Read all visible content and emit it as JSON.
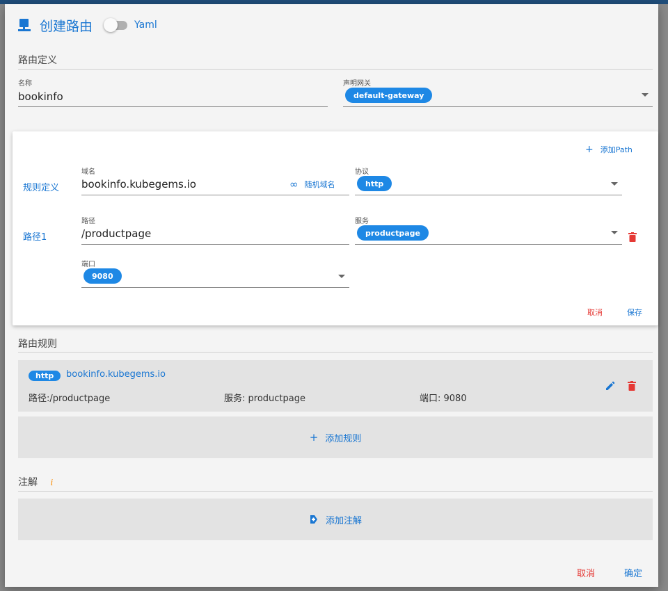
{
  "dialog": {
    "title": "创建路由",
    "yaml_label": "Yaml",
    "yaml_enabled": false
  },
  "route_def": {
    "section_title": "路由定义",
    "name_label": "名称",
    "name_value": "bookinfo",
    "gateway_label": "声明网关",
    "gateway_value": "default-gateway"
  },
  "rule_editor": {
    "add_path_label": "添加Path",
    "rule_def_label": "规则定义",
    "domain_label": "域名",
    "domain_value": "bookinfo.kubegems.io",
    "random_domain_label": "随机域名",
    "protocol_label": "协议",
    "protocol_value": "http",
    "path_row_label": "路径1",
    "path_label": "路径",
    "path_value": "/productpage",
    "service_label": "服务",
    "service_value": "productpage",
    "port_label": "端口",
    "port_value": "9080",
    "cancel_label": "取消",
    "save_label": "保存"
  },
  "route_rules": {
    "section_title": "路由规则",
    "items": [
      {
        "protocol": "http",
        "host": "bookinfo.kubegems.io",
        "path": "路径:/productpage",
        "service": "服务: productpage",
        "port": "端口: 9080"
      }
    ],
    "add_rule_label": "添加规则"
  },
  "annotations": {
    "section_title": "注解",
    "info_glyph": "i",
    "add_label": "添加注解"
  },
  "footer": {
    "cancel_label": "取消",
    "confirm_label": "确定"
  },
  "colors": {
    "primary": "#1976d2",
    "chip": "#1e88e5",
    "danger": "#e53935",
    "info": "#fb8c00"
  }
}
